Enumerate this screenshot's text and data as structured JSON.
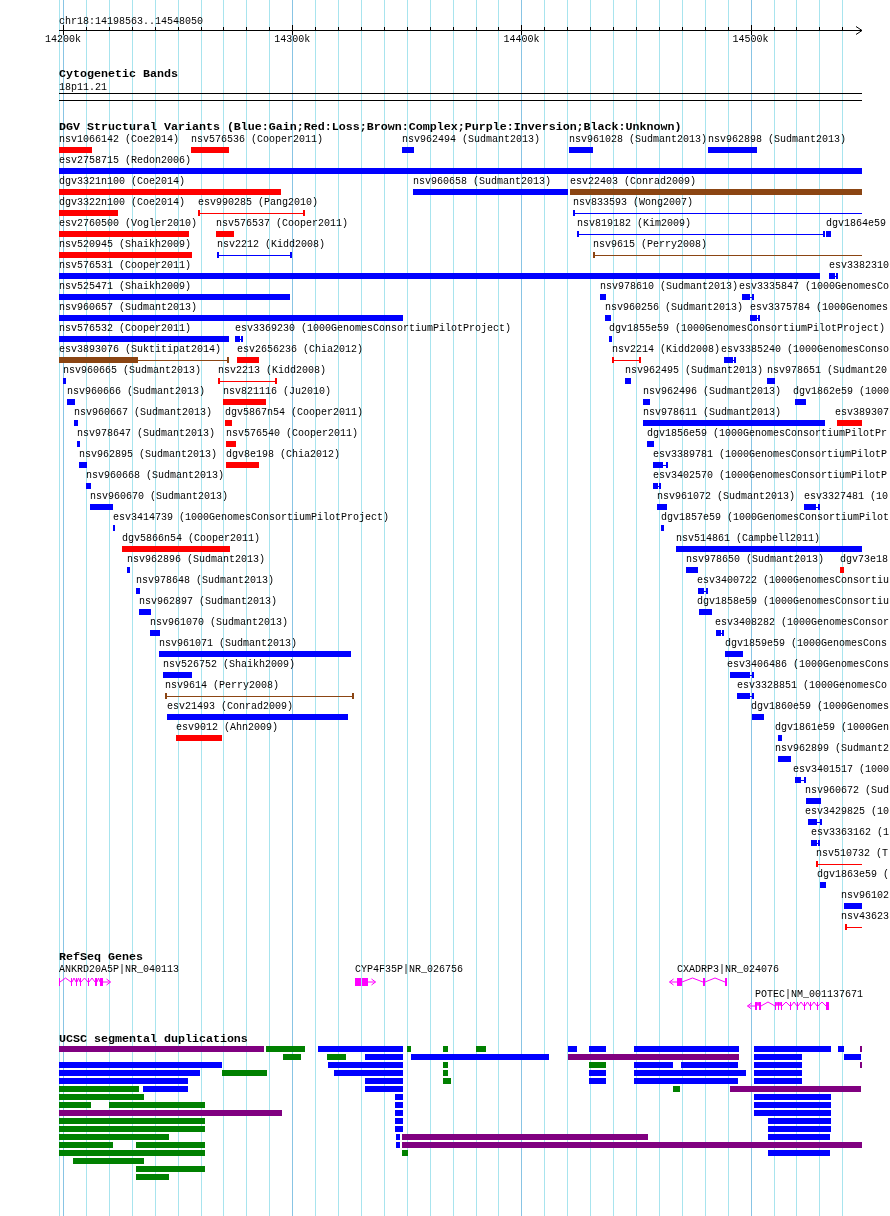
{
  "ruler": {
    "location": "chr18:14198563..14548050",
    "ticks": [
      "14200k",
      "14300k",
      "14400k",
      "14500k"
    ]
  },
  "cytogenetic_bands": {
    "title": "Cytogenetic Bands",
    "bands": [
      {
        "name": "18p11.21"
      }
    ]
  },
  "dgv_variants": {
    "title": "DGV Structural Variants (Blue:Gain;Red:Loss;Brown:Complex;Purple:Inversion;Black:Unknown)",
    "rows": [
      [
        {
          "label": "nsv1066142 (Coe2014)",
          "color": "#ff0000",
          "kind": "bar"
        },
        {
          "label": "nsv576536 (Cooper2011)",
          "color": "#ff0000",
          "kind": "bar"
        },
        {
          "label": "nsv962494 (Sudmant2013)",
          "color": "#0000ff",
          "kind": "bar"
        },
        {
          "label": "nsv961028 (Sudmant2013)",
          "color": "#0000ff",
          "kind": "bar"
        },
        {
          "label": "nsv962898 (Sudmant2013)",
          "color": "#0000ff",
          "kind": "bar"
        }
      ],
      [
        {
          "label": "esv2758715 (Redon2006)",
          "color": "#0000ff",
          "kind": "bar"
        }
      ],
      [
        {
          "label": "dgv3321n100 (Coe2014)",
          "color": "#ff0000",
          "kind": "bar"
        },
        {
          "label": "nsv960658 (Sudmant2013)",
          "color": "#0000ff",
          "kind": "bar"
        },
        {
          "label": "esv22403 (Conrad2009)",
          "color": "#8b4513",
          "kind": "bar"
        }
      ],
      [
        {
          "label": "dgv3322n100 (Coe2014)",
          "color": "#ff0000",
          "kind": "bar"
        },
        {
          "label": "esv990285 (Pang2010)",
          "color": "#ff0000",
          "kind": "span"
        },
        {
          "label": "nsv833593 (Wong2007)",
          "color": "#0000ff",
          "kind": "span"
        }
      ],
      [
        {
          "label": "esv2760500 (Vogler2010)",
          "color": "#ff0000",
          "kind": "bar"
        },
        {
          "label": "nsv576537 (Cooper2011)",
          "color": "#ff0000",
          "kind": "bar"
        },
        {
          "label": "nsv819182 (Kim2009)",
          "color": "#0000ff",
          "kind": "span"
        },
        {
          "label": "dgv1864e59",
          "color": "#0000ff",
          "kind": "bar"
        }
      ],
      [
        {
          "label": "nsv520945 (Shaikh2009)",
          "color": "#ff0000",
          "kind": "bar"
        },
        {
          "label": "nsv2212 (Kidd2008)",
          "color": "#0000ff",
          "kind": "span"
        },
        {
          "label": "nsv9615 (Perry2008)",
          "color": "#8b4513",
          "kind": "span"
        }
      ],
      [
        {
          "label": "nsv576531 (Cooper2011)",
          "color": "#0000ff",
          "kind": "bar"
        },
        {
          "label": "esv3382310",
          "color": "#0000ff",
          "kind": "mixed"
        }
      ],
      [
        {
          "label": "nsv525471 (Shaikh2009)",
          "color": "#0000ff",
          "kind": "bar"
        },
        {
          "label": "nsv978610 (Sudmant2013)",
          "color": "#0000ff",
          "kind": "bar"
        },
        {
          "label": "esv3335847 (1000GenomesCo",
          "color": "#0000ff",
          "kind": "mixed"
        }
      ],
      [
        {
          "label": "nsv960657 (Sudmant2013)",
          "color": "#0000ff",
          "kind": "bar"
        },
        {
          "label": "nsv960256 (Sudmant2013)",
          "color": "#0000ff",
          "kind": "bar"
        },
        {
          "label": "esv3375784 (1000Genomes",
          "color": "#0000ff",
          "kind": "mixed"
        }
      ],
      [
        {
          "label": "nsv576532 (Cooper2011)",
          "color": "#0000ff",
          "kind": "bar"
        },
        {
          "label": "esv3369230 (1000GenomesConsortiumPilotProject)",
          "color": "#0000ff",
          "kind": "mixed"
        },
        {
          "label": "dgv1855e59 (1000GenomesConsortiumPilotProject)",
          "color": "#0000ff",
          "kind": "bar"
        }
      ],
      [
        {
          "label": "esv3893076 (Suktitipat2014)",
          "color": "#8b4513",
          "kind": "mixed"
        },
        {
          "label": "esv2656236 (Chia2012)",
          "color": "#ff0000",
          "kind": "bar"
        },
        {
          "label": "nsv2214 (Kidd2008)",
          "color": "#ff0000",
          "kind": "span"
        },
        {
          "label": "esv3385240 (1000GenomesConso",
          "color": "#0000ff",
          "kind": "mixed"
        }
      ],
      [
        {
          "label": "nsv960665 (Sudmant2013)",
          "color": "#0000ff",
          "kind": "bar"
        },
        {
          "label": "nsv2213 (Kidd2008)",
          "color": "#ff0000",
          "kind": "span"
        },
        {
          "label": "nsv962495 (Sudmant2013)",
          "color": "#0000ff",
          "kind": "bar"
        },
        {
          "label": "nsv978651 (Sudmant20",
          "color": "#0000ff",
          "kind": "bar"
        }
      ],
      [
        {
          "label": "nsv960666 (Sudmant2013)",
          "color": "#0000ff",
          "kind": "bar"
        },
        {
          "label": "nsv821116 (Ju2010)",
          "color": "#ff0000",
          "kind": "bar"
        },
        {
          "label": "nsv962496 (Sudmant2013)",
          "color": "#0000ff",
          "kind": "bar"
        },
        {
          "label": "dgv1862e59 (1000",
          "color": "#0000ff",
          "kind": "bar"
        }
      ],
      [
        {
          "label": "nsv960667 (Sudmant2013)",
          "color": "#0000ff",
          "kind": "bar"
        },
        {
          "label": "dgv5867n54 (Cooper2011)",
          "color": "#ff0000",
          "kind": "bar"
        },
        {
          "label": "nsv978611 (Sudmant2013)",
          "color": "#0000ff",
          "kind": "bar"
        },
        {
          "label": "esv389307",
          "color": "#ff0000",
          "kind": "bar"
        }
      ],
      [
        {
          "label": "nsv978647 (Sudmant2013)",
          "color": "#0000ff",
          "kind": "bar"
        },
        {
          "label": "nsv576540 (Cooper2011)",
          "color": "#ff0000",
          "kind": "bar"
        },
        {
          "label": "dgv1856e59 (1000GenomesConsortiumPilotPr",
          "color": "#0000ff",
          "kind": "bar"
        }
      ],
      [
        {
          "label": "nsv962895 (Sudmant2013)",
          "color": "#0000ff",
          "kind": "bar"
        },
        {
          "label": "dgv8e198 (Chia2012)",
          "color": "#ff0000",
          "kind": "bar"
        },
        {
          "label": "esv3389781 (1000GenomesConsortiumPilotP",
          "color": "#0000ff",
          "kind": "mixed"
        }
      ],
      [
        {
          "label": "nsv960668 (Sudmant2013)",
          "color": "#0000ff",
          "kind": "bar"
        },
        {
          "label": "esv3402570 (1000GenomesConsortiumPilotP",
          "color": "#0000ff",
          "kind": "mixed"
        }
      ],
      [
        {
          "label": "nsv960670 (Sudmant2013)",
          "color": "#0000ff",
          "kind": "bar"
        },
        {
          "label": "nsv961072 (Sudmant2013)",
          "color": "#0000ff",
          "kind": "bar"
        },
        {
          "label": "esv3327481 (10",
          "color": "#0000ff",
          "kind": "mixed"
        }
      ],
      [
        {
          "label": "esv3414739 (1000GenomesConsortiumPilotProject)",
          "color": "#0000ff",
          "kind": "bar"
        },
        {
          "label": "dgv1857e59 (1000GenomesConsortiumPilot",
          "color": "#0000ff",
          "kind": "bar"
        }
      ],
      [
        {
          "label": "dgv5866n54 (Cooper2011)",
          "color": "#ff0000",
          "kind": "bar"
        },
        {
          "label": "nsv514861 (Campbell2011)",
          "color": "#0000ff",
          "kind": "bar"
        }
      ],
      [
        {
          "label": "nsv962896 (Sudmant2013)",
          "color": "#0000ff",
          "kind": "bar"
        },
        {
          "label": "nsv978650 (Sudmant2013)",
          "color": "#0000ff",
          "kind": "bar"
        },
        {
          "label": "dgv73e18",
          "color": "#ff0000",
          "kind": "bar"
        }
      ],
      [
        {
          "label": "nsv978648 (Sudmant2013)",
          "color": "#0000ff",
          "kind": "bar"
        },
        {
          "label": "esv3400722 (1000GenomesConsortiu",
          "color": "#0000ff",
          "kind": "mixed"
        }
      ],
      [
        {
          "label": "nsv962897 (Sudmant2013)",
          "color": "#0000ff",
          "kind": "bar"
        },
        {
          "label": "dgv1858e59 (1000GenomesConsortiu",
          "color": "#0000ff",
          "kind": "bar"
        }
      ],
      [
        {
          "label": "nsv961070 (Sudmant2013)",
          "color": "#0000ff",
          "kind": "bar"
        },
        {
          "label": "esv3408282 (1000GenomesConsor",
          "color": "#0000ff",
          "kind": "mixed"
        }
      ],
      [
        {
          "label": "nsv961071 (Sudmant2013)",
          "color": "#0000ff",
          "kind": "bar"
        },
        {
          "label": "dgv1859e59 (1000GenomesCons",
          "color": "#0000ff",
          "kind": "bar"
        }
      ],
      [
        {
          "label": "nsv526752 (Shaikh2009)",
          "color": "#0000ff",
          "kind": "bar"
        },
        {
          "label": "esv3406486 (1000GenomesCons",
          "color": "#0000ff",
          "kind": "mixed"
        }
      ],
      [
        {
          "label": "nsv9614 (Perry2008)",
          "color": "#8b4513",
          "kind": "span"
        },
        {
          "label": "esv3328851 (1000GenomesCo",
          "color": "#0000ff",
          "kind": "mixed"
        }
      ],
      [
        {
          "label": "esv21493 (Conrad2009)",
          "color": "#0000ff",
          "kind": "bar"
        },
        {
          "label": "dgv1860e59 (1000Genomes",
          "color": "#0000ff",
          "kind": "bar"
        }
      ],
      [
        {
          "label": "esv9012 (Ahn2009)",
          "color": "#ff0000",
          "kind": "bar"
        },
        {
          "label": "dgv1861e59 (1000Gen",
          "color": "#0000ff",
          "kind": "bar"
        }
      ],
      [
        {
          "label": "nsv962899 (Sudmant2",
          "color": "#0000ff",
          "kind": "bar"
        }
      ],
      [
        {
          "label": "esv3401517 (1000",
          "color": "#0000ff",
          "kind": "mixed"
        }
      ],
      [
        {
          "label": "nsv960672 (Sud",
          "color": "#0000ff",
          "kind": "bar"
        }
      ],
      [
        {
          "label": "esv3429825 (10",
          "color": "#0000ff",
          "kind": "mixed"
        }
      ],
      [
        {
          "label": "esv3363162 (1",
          "color": "#0000ff",
          "kind": "mixed"
        }
      ],
      [
        {
          "label": "nsv510732 (T",
          "color": "#ff0000",
          "kind": "span"
        }
      ],
      [
        {
          "label": "dgv1863e59 (",
          "color": "#0000ff",
          "kind": "bar"
        }
      ],
      [
        {
          "label": "nsv96102",
          "color": "#0000ff",
          "kind": "bar"
        }
      ],
      [
        {
          "label": "nsv43623",
          "color": "#ff0000",
          "kind": "span"
        }
      ]
    ]
  },
  "refseq_genes": {
    "title": "RefSeq Genes",
    "genes": [
      {
        "label": "ANKRD20A5P|NR_040113",
        "reverse_strand": false
      },
      {
        "label": "CYP4F35P|NR_026756",
        "reverse_strand": false
      },
      {
        "label": "CXADRP3|NR_024076",
        "reverse_strand": true
      },
      {
        "label": "POTEC|NM_001137671",
        "reverse_strand": true
      }
    ]
  },
  "segmental_duplications": {
    "title": "UCSC segmental duplications",
    "rows": [
      [
        {
          "color": "#800080"
        },
        {
          "color": "#008000"
        },
        {
          "color": "#0000ff"
        },
        {
          "color": "#008000"
        },
        {
          "color": "#008000"
        },
        {
          "color": "#008000"
        },
        {
          "color": "#0000ff"
        },
        {
          "color": "#0000ff"
        },
        {
          "color": "#0000ff"
        },
        {
          "color": "#0000ff"
        },
        {
          "color": "#0000ff"
        },
        {
          "color": "#800080"
        }
      ],
      [
        {
          "color": "#008000"
        },
        {
          "color": "#008000"
        },
        {
          "color": "#0000ff"
        },
        {
          "color": "#0000ff"
        },
        {
          "color": "#800080"
        },
        {
          "color": "#0000ff"
        },
        {
          "color": "#0000ff"
        }
      ],
      [
        {
          "color": "#0000ff"
        },
        {
          "color": "#0000ff"
        },
        {
          "color": "#008000"
        },
        {
          "color": "#008000"
        },
        {
          "color": "#0000ff"
        },
        {
          "color": "#0000ff"
        },
        {
          "color": "#0000ff"
        },
        {
          "color": "#800080"
        }
      ],
      [
        {
          "color": "#0000ff"
        },
        {
          "color": "#008000"
        },
        {
          "color": "#0000ff"
        },
        {
          "color": "#008000"
        },
        {
          "color": "#0000ff"
        },
        {
          "color": "#0000ff"
        },
        {
          "color": "#0000ff"
        }
      ],
      [
        {
          "color": "#0000ff"
        },
        {
          "color": "#0000ff"
        },
        {
          "color": "#008000"
        },
        {
          "color": "#0000ff"
        },
        {
          "color": "#0000ff"
        },
        {
          "color": "#0000ff"
        }
      ],
      [
        {
          "color": "#008000"
        },
        {
          "color": "#0000ff"
        },
        {
          "color": "#0000ff"
        },
        {
          "color": "#008000"
        },
        {
          "color": "#800080"
        }
      ],
      [
        {
          "color": "#008000"
        },
        {
          "color": "#0000ff"
        },
        {
          "color": "#0000ff"
        }
      ],
      [
        {
          "color": "#008000"
        },
        {
          "color": "#008000"
        },
        {
          "color": "#0000ff"
        },
        {
          "color": "#0000ff"
        }
      ],
      [
        {
          "color": "#800080"
        },
        {
          "color": "#0000ff"
        },
        {
          "color": "#0000ff"
        }
      ],
      [
        {
          "color": "#008000"
        },
        {
          "color": "#0000ff"
        },
        {
          "color": "#0000ff"
        }
      ],
      [
        {
          "color": "#008000"
        },
        {
          "color": "#0000ff"
        },
        {
          "color": "#0000ff"
        }
      ],
      [
        {
          "color": "#008000"
        },
        {
          "color": "#0000ff"
        },
        {
          "color": "#800080"
        },
        {
          "color": "#0000ff"
        }
      ],
      [
        {
          "color": "#008000"
        },
        {
          "color": "#008000"
        },
        {
          "color": "#0000ff"
        },
        {
          "color": "#800080"
        }
      ],
      [
        {
          "color": "#008000"
        },
        {
          "color": "#008000"
        },
        {
          "color": "#0000ff"
        }
      ],
      [
        {
          "color": "#008000"
        }
      ],
      [
        {
          "color": "#008000"
        }
      ],
      [
        {
          "color": "#008000"
        }
      ]
    ]
  }
}
